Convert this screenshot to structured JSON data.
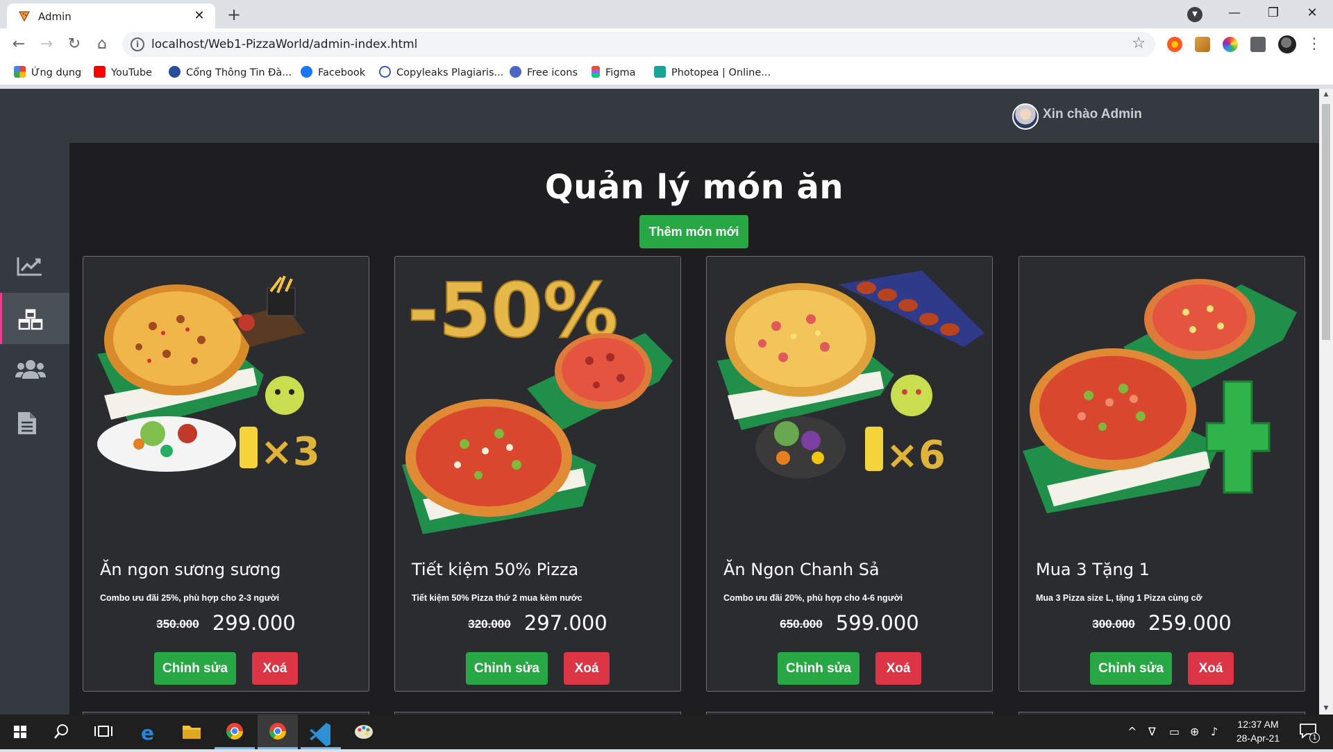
{
  "browser": {
    "tab_title": "Admin",
    "url": "localhost/Web1-PizzaWorld/admin-index.html",
    "bookmarks": [
      {
        "label": "Ứng dụng",
        "color": "#ea4335"
      },
      {
        "label": "YouTube",
        "color": "#ff0000"
      },
      {
        "label": "Cổng Thông Tin Đà...",
        "color": "#2a4d9b"
      },
      {
        "label": "Facebook",
        "color": "#1877f2"
      },
      {
        "label": "Copyleaks Plagiaris...",
        "color": "#3b5aa8"
      },
      {
        "label": "Free icons",
        "color": "#4a67c4"
      },
      {
        "label": "Figma",
        "color": "#f24e1e"
      },
      {
        "label": "Photopea | Online...",
        "color": "#18a497"
      }
    ]
  },
  "header": {
    "greeting": "Xin chào Admin"
  },
  "main": {
    "title": "Quản lý món ăn",
    "add_button": "Thêm món mới"
  },
  "products": [
    {
      "name": "Ăn ngon sương sương",
      "description": "Combo ưu đãi 25%, phù hợp cho 2-3 người",
      "old_price": "350.000",
      "price": "299.000",
      "badge": "×3",
      "edit_label": "Chỉnh sửa",
      "delete_label": "Xoá"
    },
    {
      "name": "Tiết kiệm 50% Pizza",
      "description": "Tiết kiệm 50% Pizza thứ 2 mua kèm nước",
      "old_price": "320.000",
      "price": "297.000",
      "badge": "-50%",
      "edit_label": "Chỉnh sửa",
      "delete_label": "Xoá"
    },
    {
      "name": "Ăn Ngon Chanh Sả",
      "description": "Combo ưu đãi 20%, phù hợp cho 4-6 người",
      "old_price": "650.000",
      "price": "599.000",
      "badge": "×6",
      "edit_label": "Chỉnh sửa",
      "delete_label": "Xoá"
    },
    {
      "name": "Mua 3 Tặng 1",
      "description": "Mua 3 Pizza size L, tặng 1 Pizza cùng cỡ",
      "old_price": "300.000",
      "price": "259.000",
      "badge": "+",
      "edit_label": "Chỉnh sửa",
      "delete_label": "Xoá"
    }
  ],
  "taskbar": {
    "time": "12:37 AM",
    "date": "28-Apr-21",
    "notifications": "1"
  },
  "colors": {
    "accent_green": "#28a745",
    "danger_red": "#dc3545",
    "sidebar_active": "#e83e8c"
  }
}
